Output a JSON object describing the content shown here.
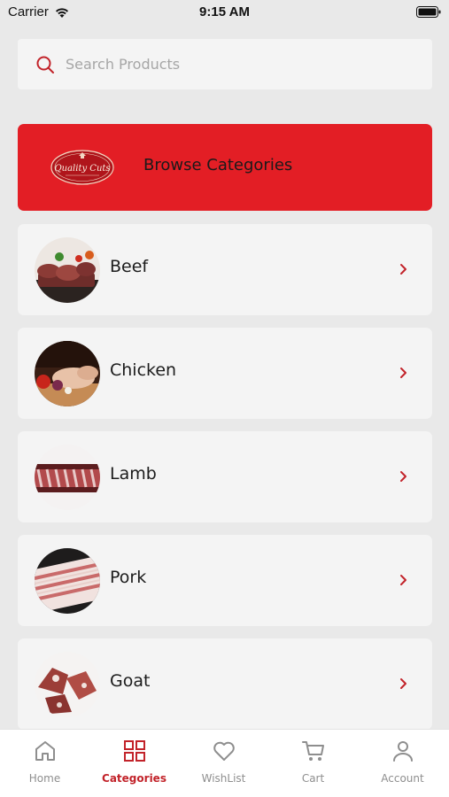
{
  "status_bar": {
    "carrier": "Carrier",
    "time": "9:15 AM"
  },
  "search": {
    "placeholder": "Search Products",
    "value": ""
  },
  "banner": {
    "logo_text": "Quality Cuts",
    "title": "Browse Categories"
  },
  "categories": [
    {
      "label": "Beef"
    },
    {
      "label": "Chicken"
    },
    {
      "label": "Lamb"
    },
    {
      "label": "Pork"
    },
    {
      "label": "Goat"
    }
  ],
  "tab_bar": {
    "tabs": [
      {
        "label": "Home",
        "icon": "home-icon"
      },
      {
        "label": "Categories",
        "icon": "grid-icon"
      },
      {
        "label": "WishList",
        "icon": "heart-icon"
      },
      {
        "label": "Cart",
        "icon": "cart-icon"
      },
      {
        "label": "Account",
        "icon": "user-icon"
      }
    ],
    "active_tab": "Categories"
  },
  "colors": {
    "accent": "#c2232a",
    "banner": "#e31e25",
    "background": "#e9e9e9",
    "card": "#f4f4f4"
  }
}
